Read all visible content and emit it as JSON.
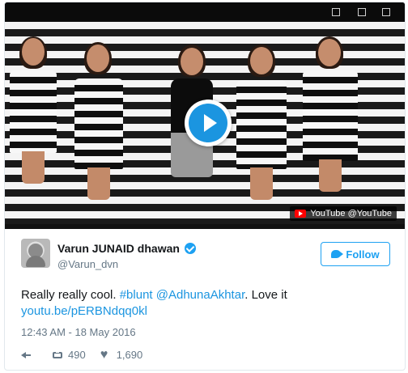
{
  "media": {
    "source_label": "YouTube @YouTube",
    "source_icon": "youtube-icon",
    "play_icon": "play-icon"
  },
  "author": {
    "name": "Varun JUNAID dhawan",
    "handle": "@Varun_dvn",
    "verified_icon": "verified-badge-icon"
  },
  "follow_button": {
    "label": "Follow",
    "icon": "twitter-bird-icon"
  },
  "tweet": {
    "text_prefix": "Really really cool. ",
    "hashtag": "#blunt",
    "text_middle_space": " ",
    "mention": "@AdhunaAkhtar",
    "text_suffix": ". Love it",
    "link": "youtu.be/pERBNdqq0kl",
    "timestamp": "12:43 AM - 18 May 2016"
  },
  "actions": {
    "reply_icon": "reply-icon",
    "retweet_icon": "retweet-icon",
    "retweets": "490",
    "like_icon": "heart-icon",
    "likes": "1,690"
  },
  "colors": {
    "accent": "#1da1f2",
    "link": "#1b95e0",
    "text": "#14171a",
    "muted": "#657786"
  }
}
